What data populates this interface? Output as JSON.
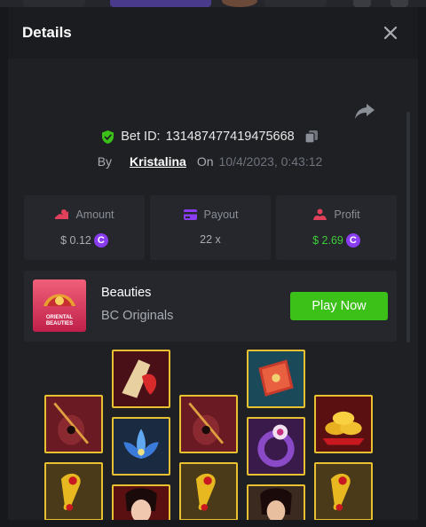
{
  "modal": {
    "title": "Details"
  },
  "bet": {
    "id_label": "Bet ID:",
    "id_value": "131487477419475668",
    "by_label": "By",
    "user": "Kristalina",
    "on_label": "On",
    "date": "10/4/2023, 0:43:12"
  },
  "stats": {
    "amount": {
      "label": "Amount",
      "value": "$ 0.12"
    },
    "payout": {
      "label": "Payout",
      "value": "22 x"
    },
    "profit": {
      "label": "Profit",
      "value": "$ 2.69"
    }
  },
  "currency": {
    "symbol": "C",
    "color": "#8a3cf0"
  },
  "game": {
    "name": "Beauties",
    "provider": "BC Originals",
    "thumb_text": "ORIENTAL BEAUTIES",
    "play_label": "Play Now"
  },
  "colors": {
    "accent_green": "#3bc117",
    "profit_green": "#3fcc3a",
    "tile_border": "#e8c030"
  },
  "slots": {
    "symbols": [
      "pipa",
      "fan",
      "pipa",
      "scroll-book",
      "gold-ingots",
      "gold-ruyi",
      "lotus",
      "gold-ruyi",
      "bracelet",
      "gold-ruyi",
      "beauty-red",
      "beauty-dark"
    ]
  }
}
